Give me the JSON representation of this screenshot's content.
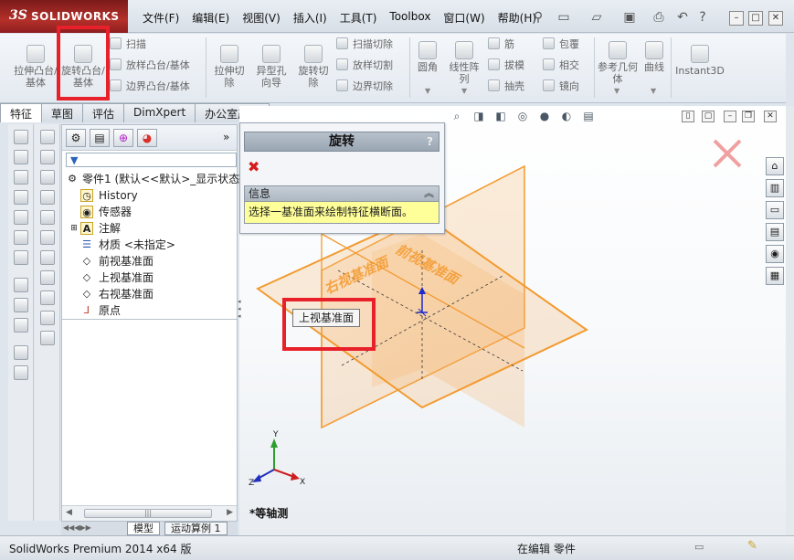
{
  "app": {
    "logo_ds": "3S",
    "logo_text": "SOLIDWORKS"
  },
  "menu": [
    "文件(F)",
    "编辑(E)",
    "视图(V)",
    "插入(I)",
    "工具(T)",
    "Toolbox",
    "窗口(W)",
    "帮助(H)"
  ],
  "ribbon": {
    "extrude_boss": "拉伸凸台/基体",
    "revolve_boss": "旋转凸台/基体",
    "sweep": "扫描",
    "loft_boss": "放样凸台/基体",
    "boundary_boss": "边界凸台/基体",
    "extrude_cut": "拉伸切除",
    "hole_wizard": "异型孔向导",
    "revolve_cut": "旋转切除",
    "swept_cut": "扫描切除",
    "lofted_cut": "放样切割",
    "boundary_cut": "边界切除",
    "fillet": "圆角",
    "linear_pattern": "线性阵列",
    "rib": "筋",
    "draft": "拔模",
    "shell": "抽壳",
    "wrap": "包覆",
    "intersect": "相交",
    "mirror": "镜向",
    "ref_geometry": "参考几何体",
    "curves": "曲线",
    "instant3d": "Instant3D"
  },
  "tabs": [
    "特征",
    "草图",
    "评估",
    "DimXpert",
    "办公室产品"
  ],
  "feature_tree": {
    "root": "零件1 (默认<<默认>_显示状态",
    "items": [
      "History",
      "传感器",
      "注解",
      "材质 <未指定>",
      "前视基准面",
      "上视基准面",
      "右视基准面",
      "原点"
    ]
  },
  "property_manager": {
    "title": "旋转",
    "help": "?",
    "info_header": "信息",
    "info_text": "选择一基准面来绘制特征横断面。"
  },
  "bottom_tabs": [
    "模型",
    "运动算例 1"
  ],
  "graphics": {
    "tooltip": "上视基准面",
    "right_plane_label": "右视基准面",
    "front_plane_label": "前视基准面",
    "view_label": "*等轴测"
  },
  "status": {
    "left": "SolidWorks Premium 2014 x64 版",
    "mid": "在编辑 零件"
  },
  "colors": {
    "highlight": "#e8202a",
    "plane": "#f39a2f",
    "info_bg": "#ffff99",
    "close_x": "#d41c1c"
  }
}
